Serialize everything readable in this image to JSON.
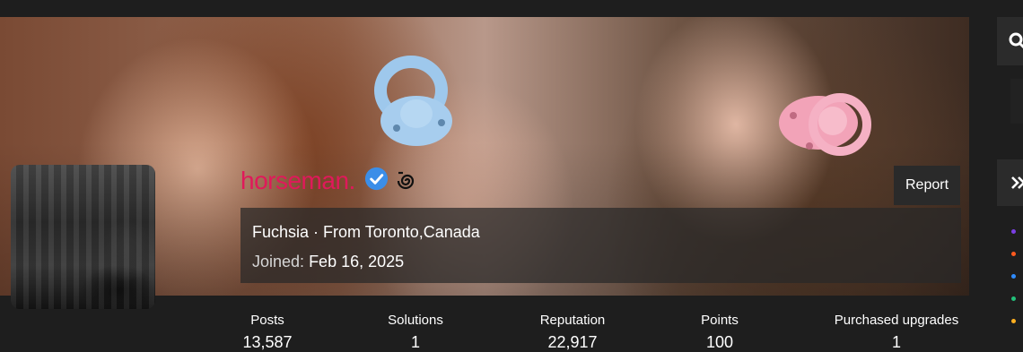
{
  "profile": {
    "username": "horseman.",
    "username_color": "#e0195a",
    "verified_icon": "verified-check-icon",
    "badge_icon": "spiral-badge-icon",
    "report_label": "Report",
    "rank": "Fuchsia",
    "separator": " · ",
    "location": "From Toronto,Canada",
    "joined_label": "Joined:",
    "joined_value": "Feb 16, 2025"
  },
  "stats": [
    {
      "label": "Posts",
      "value": "13,587"
    },
    {
      "label": "Solutions",
      "value": "1"
    },
    {
      "label": "Reputation",
      "value": "22,917"
    },
    {
      "label": "Points",
      "value": "100"
    },
    {
      "label": "Purchased upgrades",
      "value": "1"
    }
  ],
  "sidebar": {
    "search_icon": "search-icon",
    "expand_icon": "double-chevron-right-icon",
    "dot_colors": [
      "#7b3fe4",
      "#ff5a1f",
      "#2f8cff",
      "#22c07a",
      "#ffb020"
    ]
  }
}
